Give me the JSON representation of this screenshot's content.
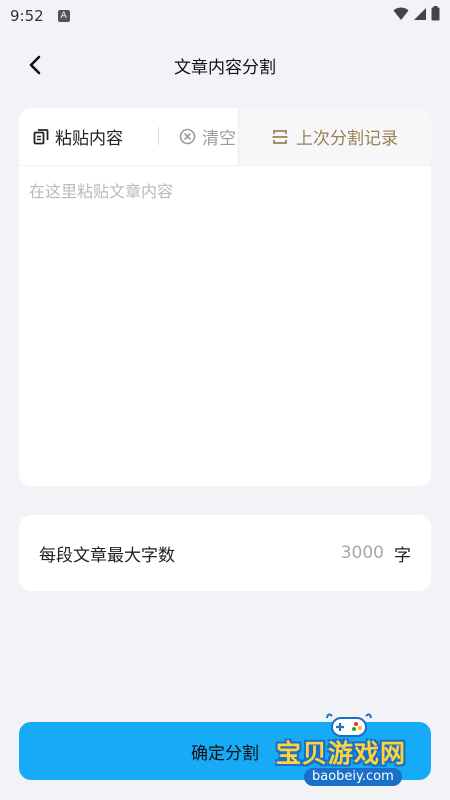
{
  "status": {
    "time": "9:52",
    "badge": "A"
  },
  "header": {
    "title": "文章内容分割"
  },
  "toolbar": {
    "paste_label": "粘贴内容",
    "clear_label": "清空",
    "history_label": "上次分割记录"
  },
  "editor": {
    "placeholder": "在这里粘贴文章内容",
    "value": ""
  },
  "setting": {
    "label": "每段文章最大字数",
    "max_chars": "3000",
    "unit": "字"
  },
  "confirm": {
    "label": "确定分割"
  },
  "watermark": {
    "text": "宝贝游戏网",
    "url": "baobeiy.com"
  },
  "colors": {
    "background": "#f2f3f7",
    "primary_button": "#16aaf7",
    "history_accent": "#9a7f52",
    "muted_text": "#9b9b9b"
  },
  "icons": [
    "back-arrow-icon",
    "paste-copy-icon",
    "clear-x-circle-icon",
    "history-split-icon",
    "wifi-icon",
    "signal-icon",
    "battery-icon"
  ]
}
